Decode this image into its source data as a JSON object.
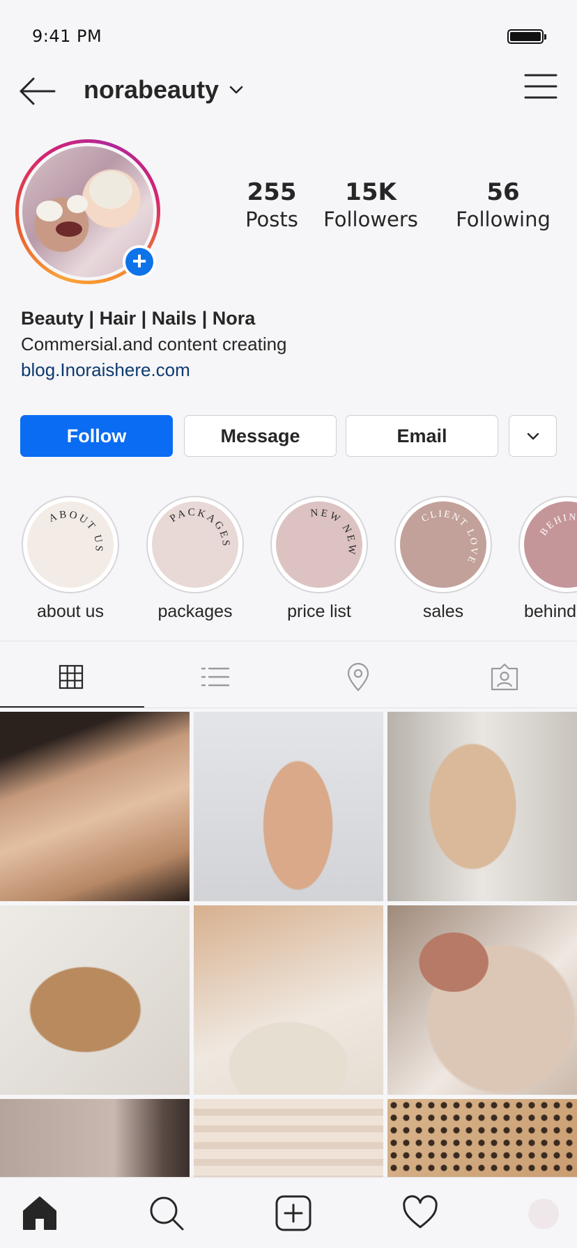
{
  "status_bar": {
    "time": "9:41 PM",
    "battery_icon": "battery-full-icon"
  },
  "header": {
    "username": "norabeauty",
    "back_icon": "arrow-left-icon",
    "dropdown_icon": "chevron-down-icon",
    "menu_icon": "hamburger-menu-icon"
  },
  "profile": {
    "add_story_icon": "plus-circle-icon"
  },
  "stats": [
    {
      "value": "255",
      "label": "Posts"
    },
    {
      "value": "15K",
      "label": "Followers"
    },
    {
      "value": "56",
      "label": "Following"
    }
  ],
  "bio": {
    "name": "Beauty | Hair | Nails | Nora",
    "text": "Commersial.and content creating",
    "link": "blog.Inoraishere.com"
  },
  "actions": {
    "follow": "Follow",
    "message": "Message",
    "email": "Email",
    "more_icon": "chevron-down-icon"
  },
  "highlights": [
    {
      "label": "about us",
      "arc_text": "ABOUT US",
      "color": "#f3ece6"
    },
    {
      "label": "packages",
      "arc_text": "PACKAGES",
      "color": "#e8d9d6"
    },
    {
      "label": "price list",
      "arc_text": "NEW NEW",
      "color": "#dcc3c2"
    },
    {
      "label": "sales",
      "arc_text": "CLIENT LOVE",
      "color": "#c2a19a"
    },
    {
      "label": "behind",
      "arc_text": "BEHIND SCENES",
      "color": "#c49599"
    }
  ],
  "tabs": [
    {
      "name": "grid-icon"
    },
    {
      "name": "list-icon"
    },
    {
      "name": "location-pin-icon"
    },
    {
      "name": "tagged-person-icon"
    }
  ],
  "bottom_nav": [
    {
      "name": "home-icon"
    },
    {
      "name": "search-icon"
    },
    {
      "name": "new-post-icon"
    },
    {
      "name": "heart-icon"
    },
    {
      "name": "profile-avatar"
    }
  ],
  "colors": {
    "accent": "#0a6cf2",
    "link": "#0d3a70"
  }
}
